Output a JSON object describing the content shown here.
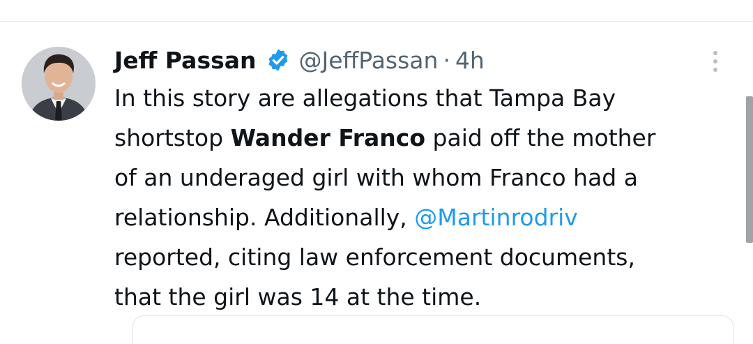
{
  "tweet": {
    "author_name": "Jeff Passan",
    "handle": "@JeffPassan",
    "separator": "·",
    "time": "4h",
    "verified_icon": "verified-badge-icon",
    "more_icon": "vertical-ellipsis-icon",
    "avatar": "profile-photo",
    "text": {
      "line1": "In this story are allegations that Tampa Bay",
      "line2_pre": "shortstop ",
      "line2_bold": "Wander Franco",
      "line2_post": " paid off the mother",
      "line3": "of an underaged girl with whom Franco had a",
      "line4_pre": "relationship. Additionally, ",
      "line4_mention": "@Martinrodriv",
      "line5": "reported, citing law enforcement documents,",
      "line6": "that the girl was 14 at the time."
    }
  },
  "colors": {
    "text": "#0f1419",
    "secondary": "#536471",
    "link": "#1d9bf0",
    "verified": "#1d9bf0"
  }
}
